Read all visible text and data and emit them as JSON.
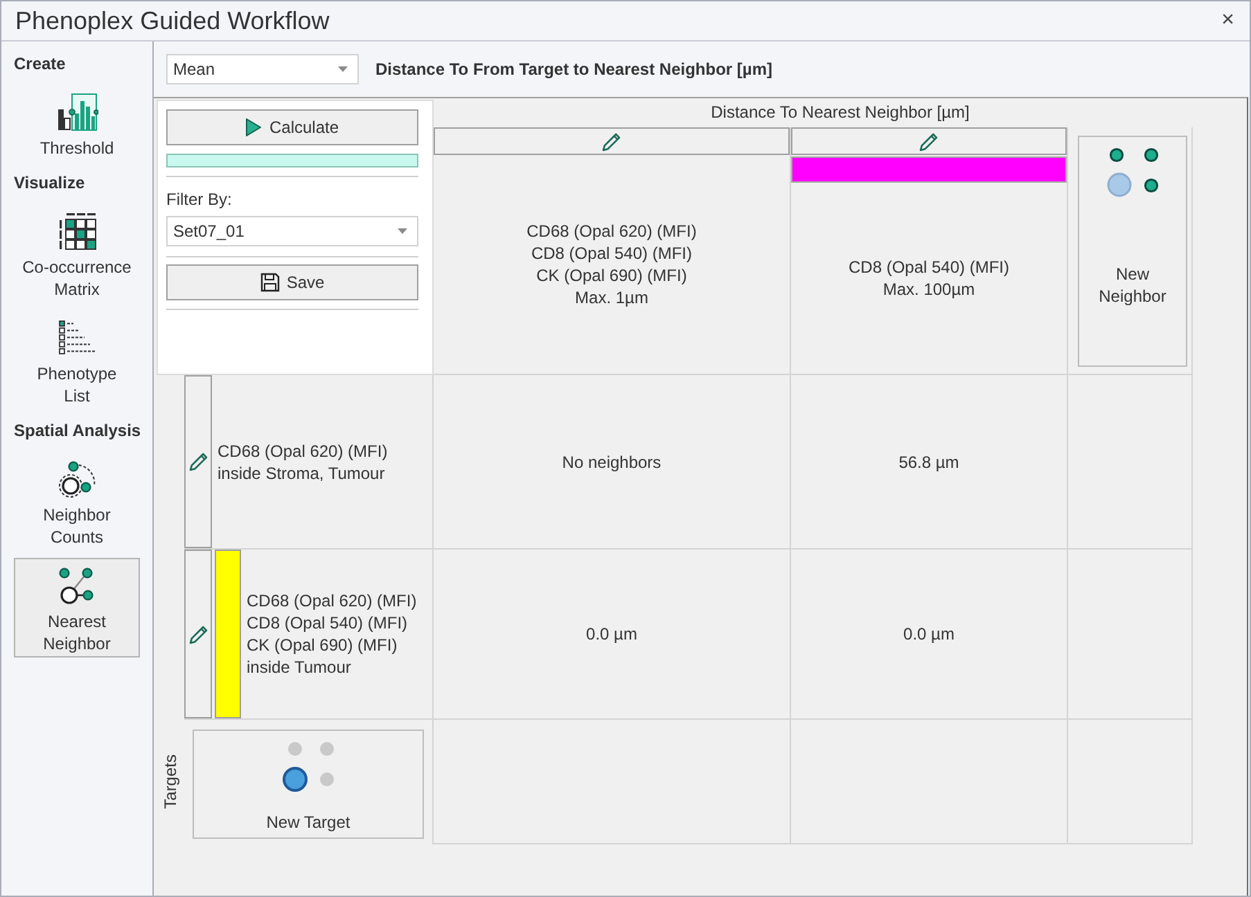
{
  "window": {
    "title": "Phenoplex Guided Workflow",
    "close": "×"
  },
  "sidebar": {
    "sections": [
      {
        "title": "Create",
        "items": [
          {
            "kind": "threshold",
            "label": "Threshold",
            "selected": false
          }
        ]
      },
      {
        "title": "Visualize",
        "items": [
          {
            "kind": "matrix",
            "label": "Co-occurrence\nMatrix",
            "selected": false
          },
          {
            "kind": "list",
            "label": "Phenotype\nList",
            "selected": false
          }
        ]
      },
      {
        "title": "Spatial Analysis",
        "items": [
          {
            "kind": "counts",
            "label": "Neighbor\nCounts",
            "selected": false
          },
          {
            "kind": "nearest",
            "label": "Nearest\nNeighbor",
            "selected": true
          }
        ]
      }
    ]
  },
  "toolbar": {
    "statistic": {
      "value": "Mean"
    },
    "heading": "Distance To From Target to Nearest Neighbor [µm]"
  },
  "side_panel": {
    "calculate_button": "Calculate",
    "progress": {
      "level": 1
    },
    "filter_label": "Filter By:",
    "filter": {
      "value": "Set07_01"
    },
    "save_button": "Save"
  },
  "grid": {
    "neighbors_heading": "Distance To Nearest Neighbor [µm]",
    "neighbors": [
      {
        "label": "CD68 (Opal 620) (MFI)\nCD8 (Opal 540) (MFI)\nCK (Opal 690) (MFI)\nMax. 1µm"
      },
      {
        "label": "CD8 (Opal 540) (MFI)\nMax. 100µm",
        "color": "#ff00ff"
      }
    ],
    "new_neighbor_button": "New\nNeighbor",
    "targets_label": "Targets",
    "targets": [
      {
        "label": "CD68 (Opal 620) (MFI)\ninside Stroma, Tumour",
        "values": [
          "No neighbors",
          "56.8 µm"
        ]
      },
      {
        "label": "CD68 (Opal 620) (MFI)\nCD8 (Opal 540) (MFI)\nCK (Opal 690) (MFI)\ninside Tumour",
        "color": "#ffff00",
        "values": [
          "0.0 µm",
          "0.0 µm"
        ]
      }
    ],
    "new_target_button": "New Target"
  }
}
